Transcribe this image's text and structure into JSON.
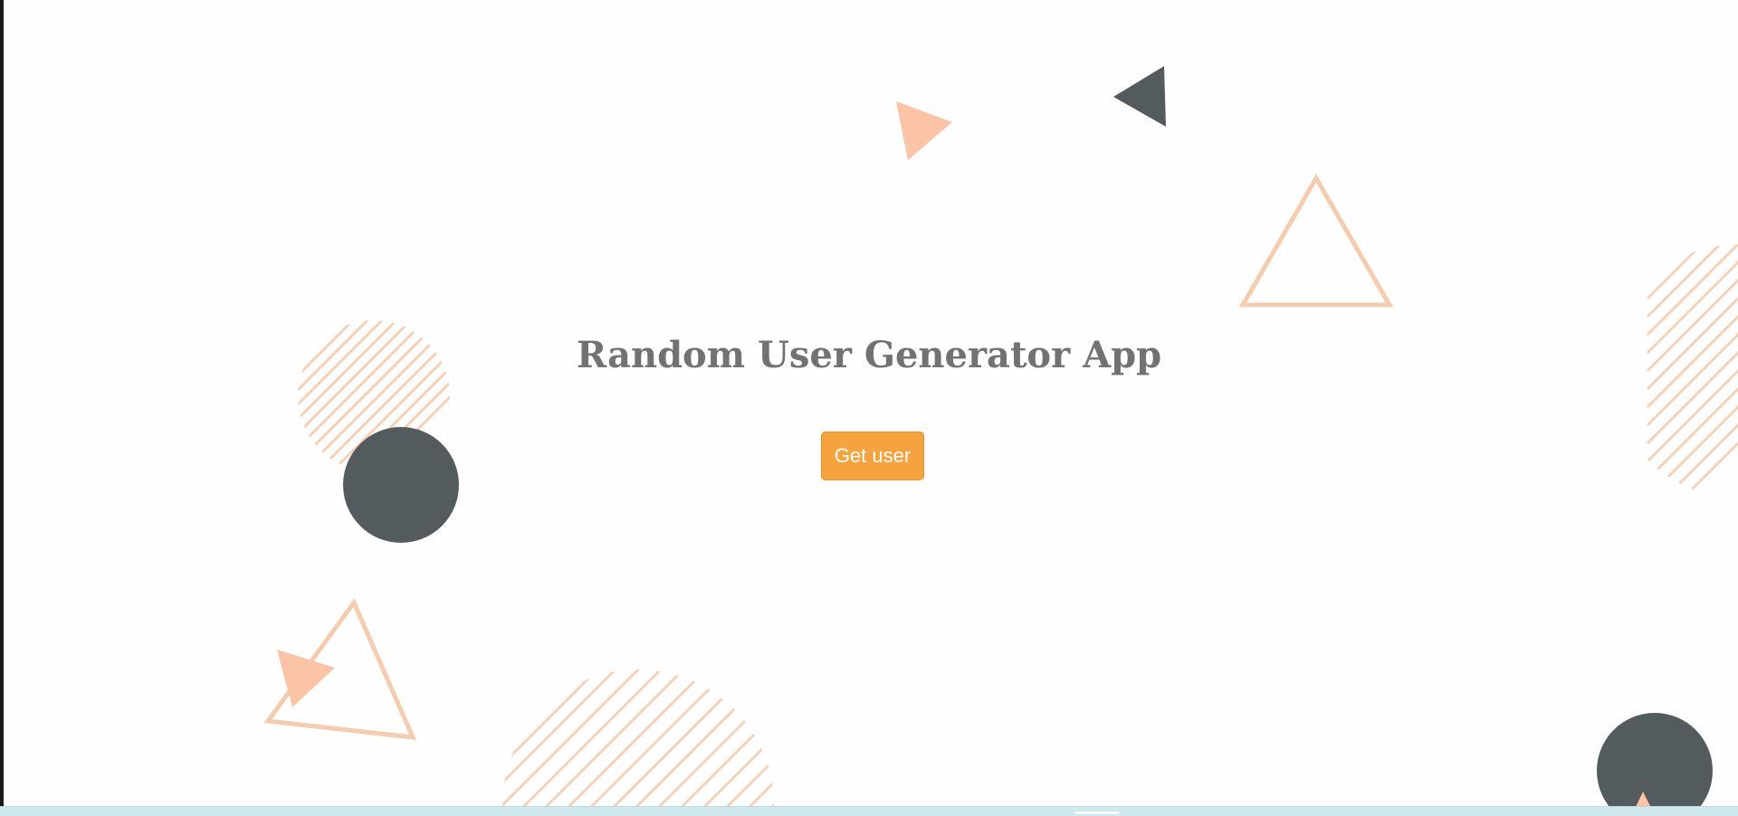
{
  "app": {
    "title": "Random User Generator App",
    "get_user_label": "Get user"
  },
  "colors": {
    "background": "#fefefe",
    "title": "#727272",
    "button": "#f5a33f",
    "dark_shape": "#545b5f",
    "peach_fill": "#fcc4a6",
    "peach_outline": "#f4cdb0",
    "bottom_bar": "#cfe8ee"
  }
}
